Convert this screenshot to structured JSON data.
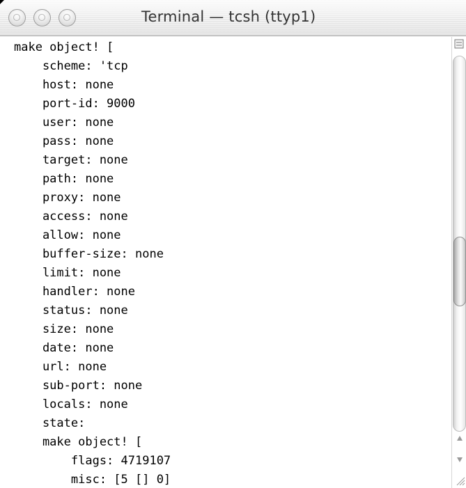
{
  "window": {
    "title": "Terminal — tcsh (ttyp1)"
  },
  "terminal": {
    "lines": [
      "make object! [",
      "    scheme: 'tcp",
      "    host: none",
      "    port-id: 9000",
      "    user: none",
      "    pass: none",
      "    target: none",
      "    path: none",
      "    proxy: none",
      "    access: none",
      "    allow: none",
      "    buffer-size: none",
      "    limit: none",
      "    handler: none",
      "    status: none",
      "    size: none",
      "    date: none",
      "    url: none",
      "    sub-port: none",
      "    locals: none",
      "    state:",
      "    make object! [",
      "        flags: 4719107",
      "        misc: [5 [] 0]"
    ]
  },
  "icons": {
    "close": "close-button-icon",
    "minimize": "minimize-button-icon",
    "zoom": "zoom-button-icon",
    "split": "split-pane-icon",
    "scroll_up": "scroll-up-arrow-icon",
    "scroll_down": "scroll-down-arrow-icon",
    "resize": "resize-grip-icon"
  }
}
